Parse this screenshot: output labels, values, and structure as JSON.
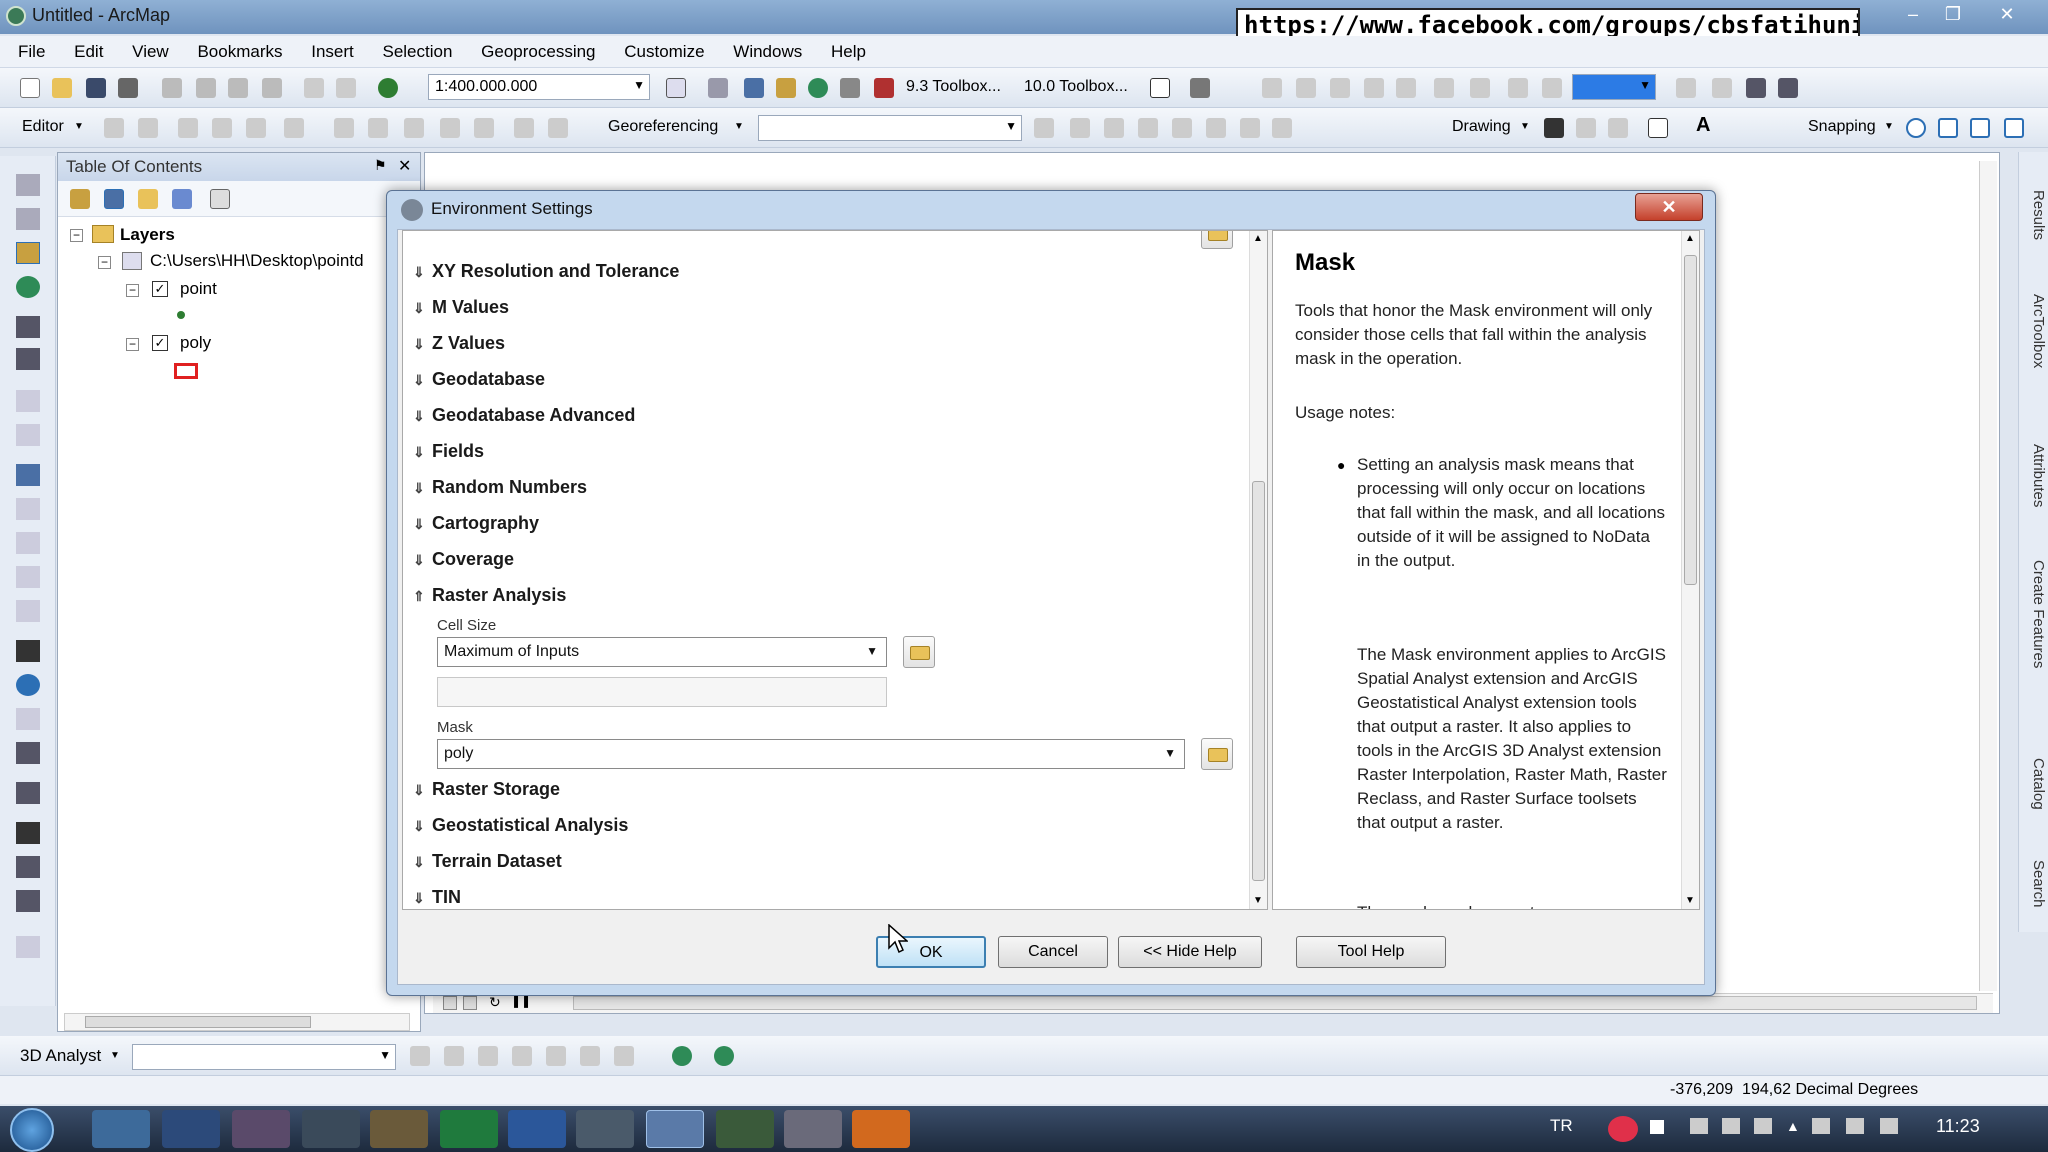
{
  "window": {
    "title": "Untitled - ArcMap"
  },
  "overlay_url": "https://www.facebook.com/groups/cbsfatihuni/",
  "menu": [
    "File",
    "Edit",
    "View",
    "Bookmarks",
    "Insert",
    "Selection",
    "Geoprocessing",
    "Customize",
    "Windows",
    "Help"
  ],
  "toolbar": {
    "scale": "1:400.000.000",
    "toolbox93": "9.3 Toolbox...",
    "toolbox100": "10.0 Toolbox...",
    "editor": "Editor",
    "georeferencing": "Georeferencing",
    "drawing": "Drawing",
    "snapping": "Snapping",
    "analyst3d": "3D Analyst"
  },
  "toc": {
    "title": "Table Of Contents",
    "root": "Layers",
    "path": "C:\\Users\\HH\\Desktop\\pointd",
    "layers": [
      "point",
      "poly"
    ]
  },
  "dialog": {
    "title": "Environment Settings",
    "sections_top": [
      "XY Resolution and Tolerance",
      "M Values",
      "Z Values",
      "Geodatabase",
      "Geodatabase Advanced",
      "Fields",
      "Random Numbers",
      "Cartography",
      "Coverage"
    ],
    "raster_analysis": {
      "title": "Raster Analysis",
      "cell_size_label": "Cell Size",
      "cell_size_value": "Maximum of Inputs",
      "mask_label": "Mask",
      "mask_value": "poly"
    },
    "sections_bottom": [
      "Raster Storage",
      "Geostatistical Analysis",
      "Terrain Dataset",
      "TIN"
    ],
    "help": {
      "title": "Mask",
      "intro": "Tools that honor the Mask environment will only consider those cells that fall within the analysis mask in the operation.",
      "usage": "Usage notes:",
      "bullet1": "Setting an analysis mask means that processing will only occur on locations that fall within the mask, and all locations outside of it will be assigned to NoData in the output.",
      "para2": "The Mask environment applies to ArcGIS Spatial Analyst extension and ArcGIS Geostatistical Analyst extension tools that output a raster. It also applies to tools in the ArcGIS 3D Analyst extension Raster Interpolation, Raster Math, Raster Reclass, and Raster Surface toolsets that output a raster.",
      "bullet2": "The mask can be a raster or a"
    },
    "buttons": {
      "ok": "OK",
      "cancel": "Cancel",
      "hide_help": "<< Hide Help",
      "tool_help": "Tool Help"
    }
  },
  "dock_tabs": [
    "Results",
    "ArcToolbox",
    "Attributes",
    "Create Features",
    "Catalog",
    "Search"
  ],
  "status": {
    "coords": "-376,209  194,62 Decimal Degrees"
  },
  "taskbar": {
    "lang": "TR",
    "time": "11:23"
  }
}
